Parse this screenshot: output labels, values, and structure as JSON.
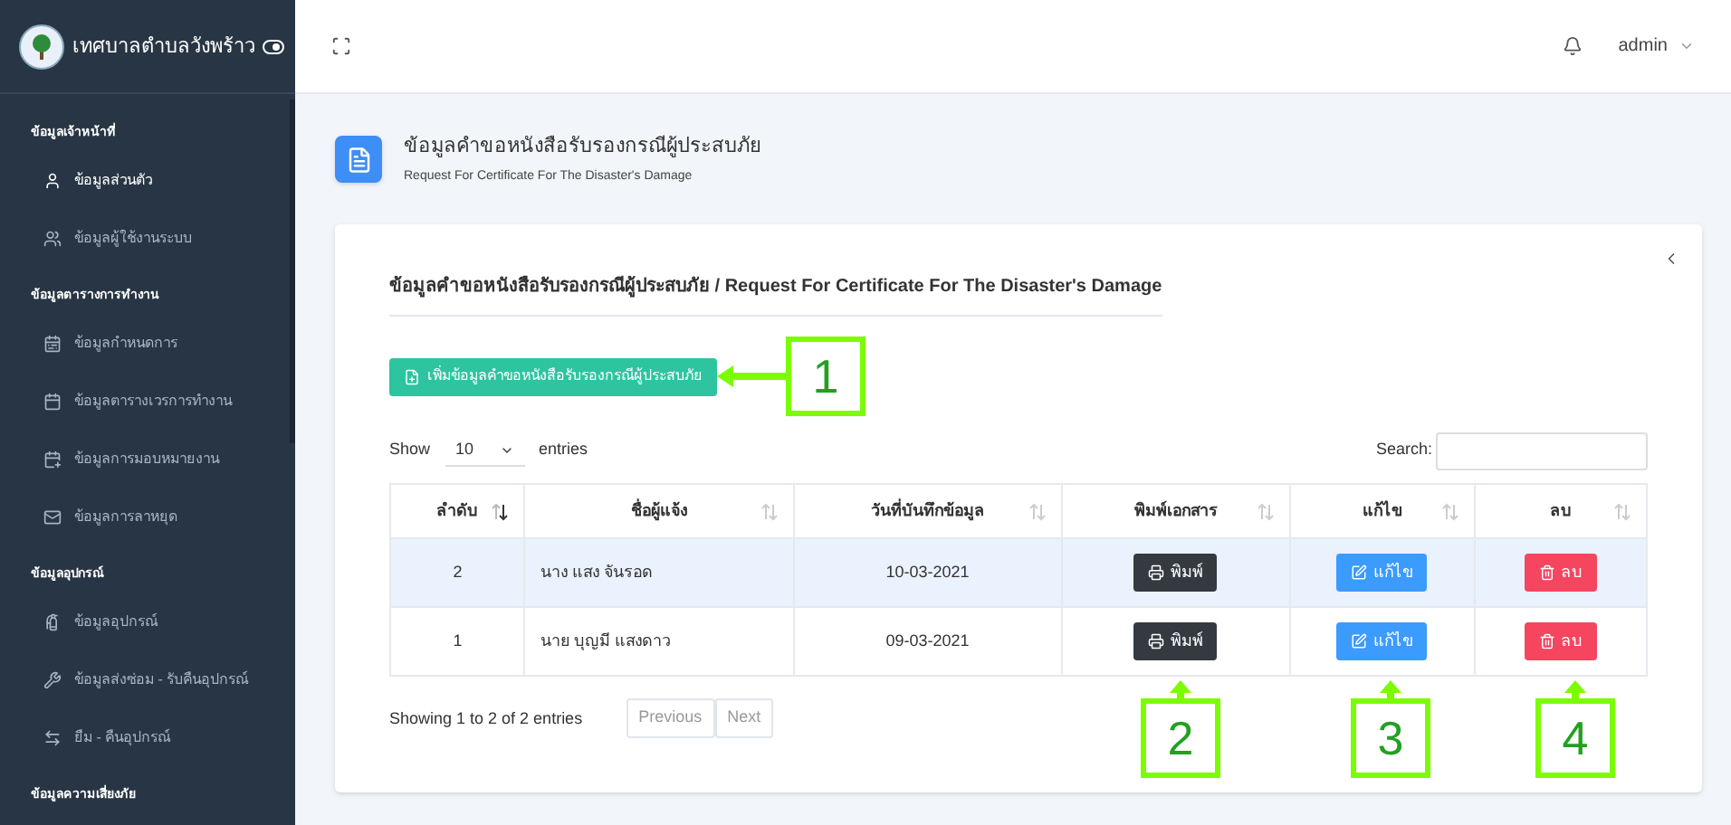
{
  "sidebar": {
    "brand": "เทศบาลตำบลวังพร้าว",
    "sections": [
      {
        "heading": "ข้อมูลเจ้าหน้าที่",
        "items": [
          {
            "label": "ข้อมูลส่วนตัว",
            "selected": true
          },
          {
            "label": "ข้อมูลผู้ใช้งานระบบ",
            "selected": false
          }
        ]
      },
      {
        "heading": "ข้อมูลตารางการทำงาน",
        "items": [
          {
            "label": "ข้อมูลกำหนดการ",
            "selected": false
          },
          {
            "label": "ข้อมูลตารางเวรการทำงาน",
            "selected": false
          },
          {
            "label": "ข้อมูลการมอบหมายงาน",
            "selected": false
          },
          {
            "label": "ข้อมูลการลาหยุด",
            "selected": false
          }
        ]
      },
      {
        "heading": "ข้อมูลอุปกรณ์",
        "items": [
          {
            "label": "ข้อมูลอุปกรณ์",
            "selected": false
          },
          {
            "label": "ข้อมูลส่งซ่อม - รับคืนอุปกรณ์",
            "selected": false
          },
          {
            "label": "ยืม - คืนอุปกรณ์",
            "selected": false
          }
        ]
      },
      {
        "heading": "ข้อมูลความเสี่ยงภัย"
      }
    ]
  },
  "topbar": {
    "user": "admin"
  },
  "page_header": {
    "title": "ข้อมูลคำขอหนังสือรับรองกรณีผู้ประสบภัย",
    "subtitle": "Request For Certificate For The Disaster's Damage"
  },
  "card": {
    "title": "ข้อมูลคำขอหนังสือรับรองกรณีผู้ประสบภัย / Request For Certificate For The Disaster's Damage",
    "add_button": "เพิ่มข้อมูลคำขอหนังสือรับรองกรณีผู้ประสบภัย",
    "length": {
      "show": "Show",
      "value": "10",
      "entries": "entries"
    },
    "search": {
      "label": "Search:"
    },
    "table": {
      "columns": [
        {
          "label": "ลำดับ",
          "sorted": true
        },
        {
          "label": "ชื่อผู้แจ้ง",
          "sorted": false
        },
        {
          "label": "วันที่บันทึกข้อมูล",
          "sorted": false
        },
        {
          "label": "พิมพ์เอกสาร",
          "sorted": false
        },
        {
          "label": "แก้ไข",
          "sorted": false
        },
        {
          "label": "ลบ",
          "sorted": false
        }
      ],
      "rows": [
        {
          "selected": true,
          "cells": [
            "2",
            "นาง แสง จันรอด",
            "10-03-2021"
          ],
          "actions": [
            {
              "kind": "print",
              "label": "พิมพ์"
            },
            {
              "kind": "edit",
              "label": "แก้ไข"
            },
            {
              "kind": "delete",
              "label": "ลบ"
            }
          ]
        },
        {
          "selected": false,
          "cells": [
            "1",
            "นาย บุญมี แสงดาว",
            "09-03-2021"
          ],
          "actions": [
            {
              "kind": "print",
              "label": "พิมพ์"
            },
            {
              "kind": "edit",
              "label": "แก้ไข"
            },
            {
              "kind": "delete",
              "label": "ลบ"
            }
          ]
        }
      ]
    },
    "info": "Showing 1 to 2 of 2 entries",
    "pagination": {
      "previous": "Previous",
      "next": "Next"
    }
  },
  "callouts": [
    "1",
    "2",
    "3",
    "4"
  ]
}
